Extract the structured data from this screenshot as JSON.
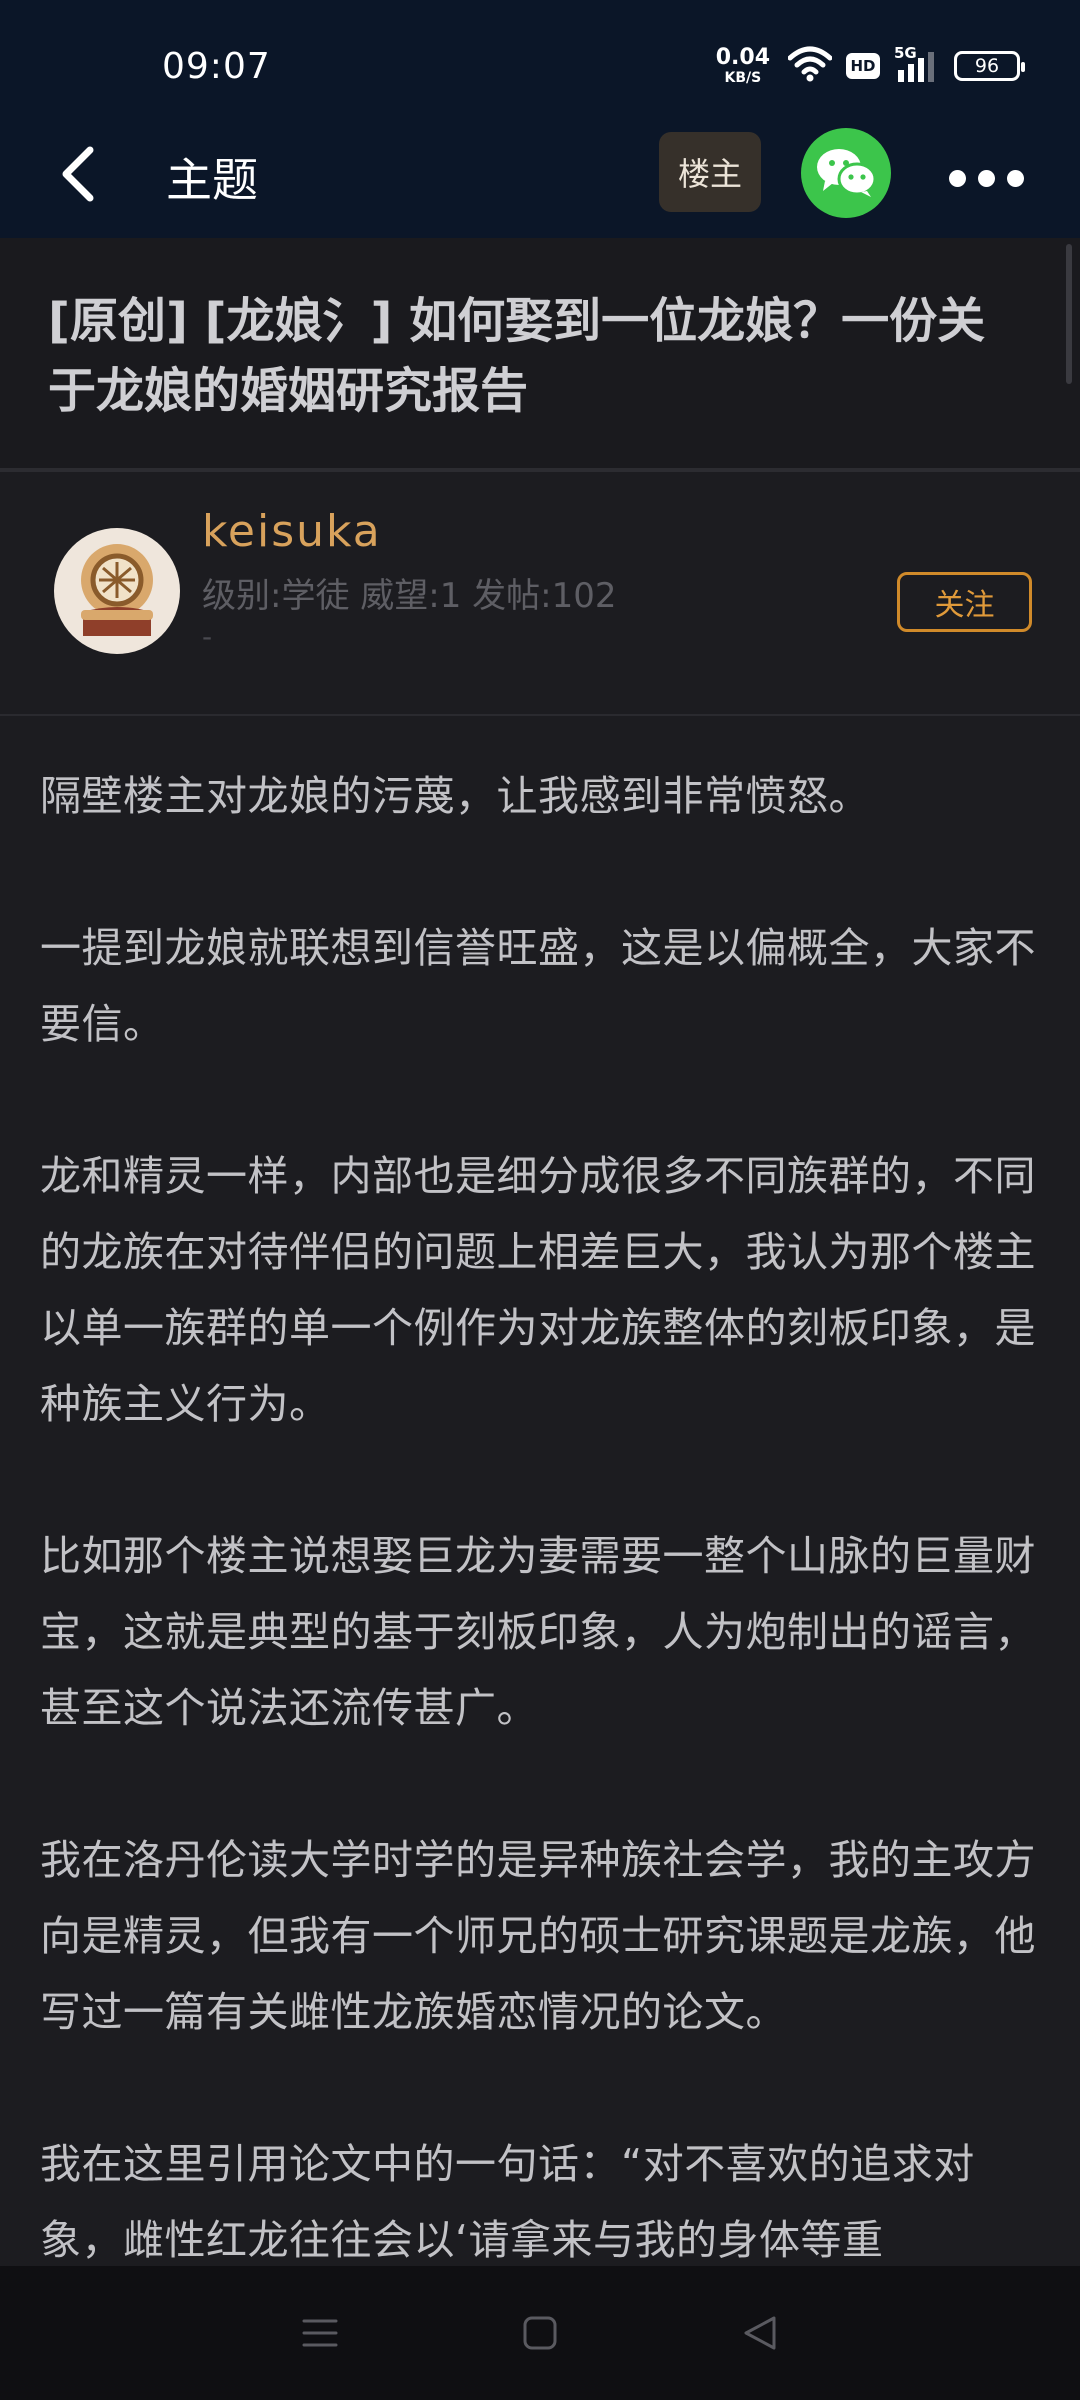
{
  "status_bar": {
    "time": "09:07",
    "net_speed_value": "0.04",
    "net_speed_unit": "KB/S",
    "hd": "HD",
    "network": "5G",
    "battery": "96"
  },
  "app_bar": {
    "title": "主题",
    "op_label": "楼主"
  },
  "post": {
    "title": "[原创] [龙娘氵] 如何娶到一位龙娘？一份关于龙娘的婚姻研究报告"
  },
  "author": {
    "name": "keisuka",
    "meta": "级别:学徒 威望:1 发帖:102",
    "signature": "-",
    "follow_label": "关注"
  },
  "content": {
    "paragraphs": [
      "隔壁楼主对龙娘的污蔑，让我感到非常愤怒。",
      "一提到龙娘就联想到信誉旺盛，这是以偏概全，大家不要信。",
      "龙和精灵一样，内部也是细分成很多不同族群的，不同的龙族在对待伴侣的问题上相差巨大，我认为那个楼主以单一族群的单一个例作为对龙族整体的刻板印象，是种族主义行为。",
      "比如那个楼主说想娶巨龙为妻需要一整个山脉的巨量财宝，这就是典型的基于刻板印象，人为炮制出的谣言，甚至这个说法还流传甚广。",
      "我在洛丹伦读大学时学的是异种族社会学，我的主攻方向是精灵，但我有一个师兄的硕士研究课题是龙族，他写过一篇有关雌性龙族婚恋情况的论文。",
      "我在这里引用论文中的一句话：“对不喜欢的追求对象，雌性红龙往往会以‘请拿来与我的身体等重"
    ]
  },
  "icons": {
    "back": "chevron-left-icon",
    "wechat": "wechat-icon",
    "more": "more-dots-icon",
    "wifi": "wifi-icon",
    "signal": "signal-icon",
    "nav_menu": "menu-icon",
    "nav_home": "square-home-icon",
    "nav_back": "triangle-back-icon"
  },
  "colors": {
    "header_bg": "#0b1628",
    "page_bg": "#1c1c20",
    "author_name": "#d8a25c",
    "follow_border": "#d08a2a",
    "wechat_green": "#3cc54b"
  }
}
